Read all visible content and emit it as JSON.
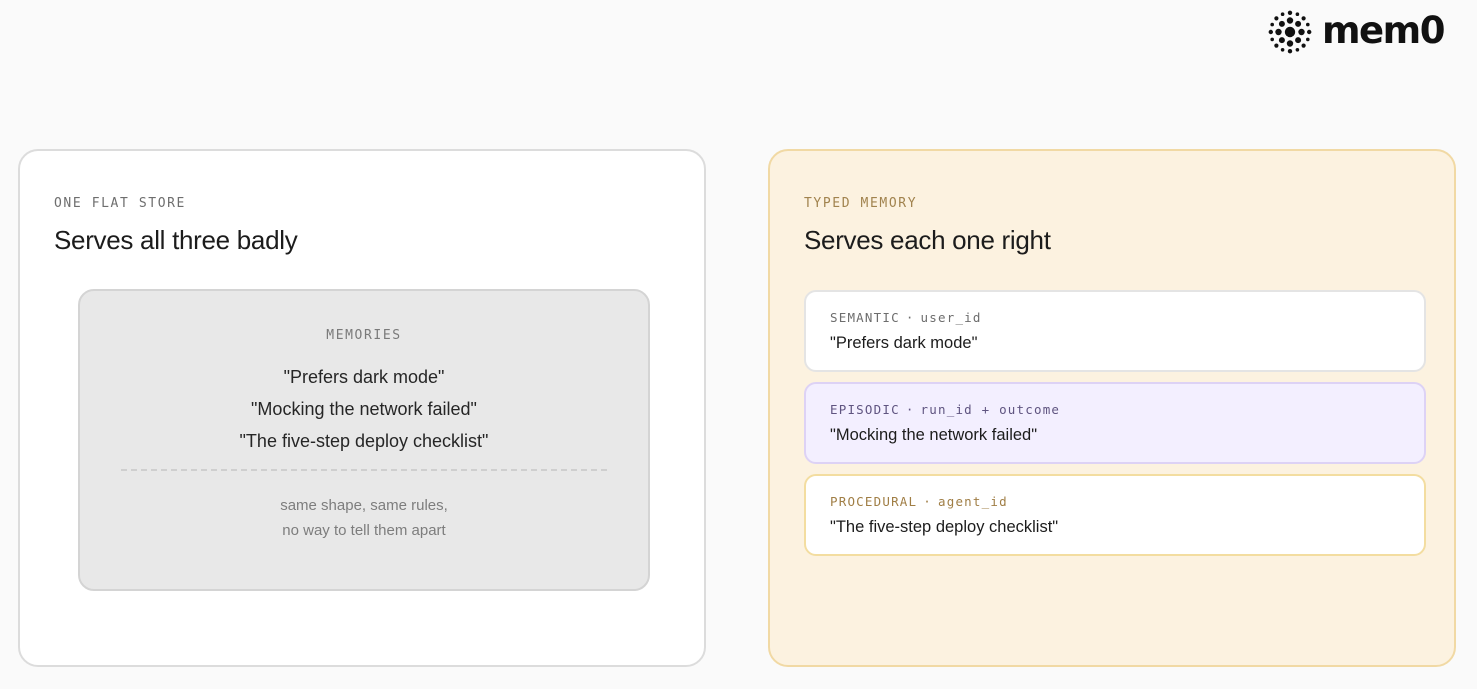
{
  "brand": {
    "logo_icon": "mem0-dots-icon",
    "wordmark": "mem0"
  },
  "left_panel": {
    "eyebrow": "ONE FLAT STORE",
    "heading": "Serves all three badly",
    "store": {
      "label": "MEMORIES",
      "items": [
        "\"Prefers dark mode\"",
        "\"Mocking the network failed\"",
        "\"The five-step deploy checklist\""
      ],
      "note_line1": "same shape, same rules,",
      "note_line2": "no way to tell them apart"
    }
  },
  "right_panel": {
    "eyebrow": "TYPED MEMORY",
    "heading": "Serves each one right",
    "separator": "·",
    "cards": [
      {
        "type": "SEMANTIC",
        "key": "user_id",
        "value": "\"Prefers dark mode\""
      },
      {
        "type": "EPISODIC",
        "key": "run_id + outcome",
        "value": "\"Mocking the network failed\""
      },
      {
        "type": "PROCEDURAL",
        "key": "agent_id",
        "value": "\"The five-step deploy checklist\""
      }
    ]
  },
  "colors": {
    "right_panel_bg": "#fcf2e0",
    "right_panel_border": "#f1d9a4",
    "episodic_bg": "#f3efff",
    "store_bg": "#e8e8e8"
  }
}
